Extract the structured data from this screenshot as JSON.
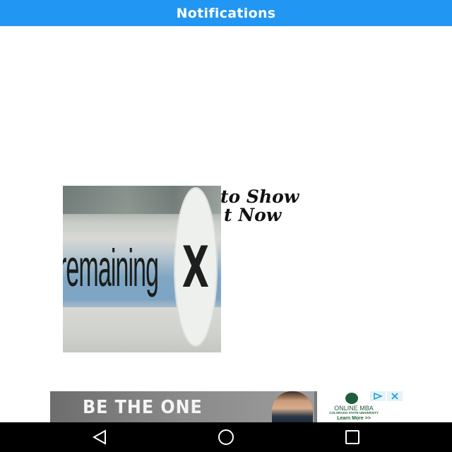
{
  "header": {
    "title": "Notifications"
  },
  "empty_state": {
    "line1": "to Show",
    "line2": "t Now"
  },
  "overlay_image": {
    "text": "remaining",
    "close_glyph": "X"
  },
  "ad": {
    "headline": "BE THE ONE",
    "online_label": "ONLINE MBA",
    "university": "COLORADO STATE UNIVERSITY",
    "cta": "Learn More >>",
    "icons": [
      "adchoices-icon",
      "close-icon"
    ]
  },
  "navbar": {
    "icons": [
      "back-icon",
      "home-icon",
      "recents-icon"
    ]
  },
  "colors": {
    "accent": "#2196f3",
    "nav_bg": "#000000",
    "text": "#111111"
  }
}
